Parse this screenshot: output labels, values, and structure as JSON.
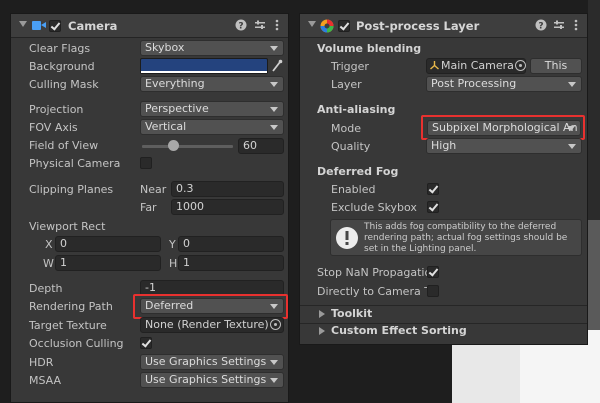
{
  "camera": {
    "title": "Camera",
    "icons": [
      "camera-icon",
      "help-icon",
      "preset-icon",
      "more-icon"
    ],
    "accent_color": "#4a9ff5",
    "rows": {
      "clear_flags": {
        "label": "Clear Flags",
        "value": "Skybox"
      },
      "background": {
        "label": "Background",
        "color": "#24437e"
      },
      "culling_mask": {
        "label": "Culling Mask",
        "value": "Everything"
      },
      "projection": {
        "label": "Projection",
        "value": "Perspective"
      },
      "fov_axis": {
        "label": "FOV Axis",
        "value": "Vertical"
      },
      "field_of_view": {
        "label": "Field of View",
        "value": "60"
      },
      "physical_camera": {
        "label": "Physical Camera",
        "checked": false
      },
      "clipping_planes": {
        "label": "Clipping Planes",
        "near_label": "Near",
        "near": "0.3",
        "far_label": "Far",
        "far": "1000"
      },
      "viewport_rect": {
        "label": "Viewport Rect",
        "x_label": "X",
        "x": "0",
        "y_label": "Y",
        "y": "0",
        "w_label": "W",
        "w": "1",
        "h_label": "H",
        "h": "1"
      },
      "depth": {
        "label": "Depth",
        "value": "-1"
      },
      "rendering_path": {
        "label": "Rendering Path",
        "value": "Deferred"
      },
      "target_texture": {
        "label": "Target Texture",
        "value": "None (Render Texture)"
      },
      "occlusion_culling": {
        "label": "Occlusion Culling",
        "checked": true
      },
      "hdr": {
        "label": "HDR",
        "value": "Use Graphics Settings"
      },
      "msaa": {
        "label": "MSAA",
        "value": "Use Graphics Settings"
      }
    }
  },
  "postprocess": {
    "title": "Post-process Layer",
    "icons": [
      "postprocess-icon",
      "help-icon",
      "preset-icon",
      "more-icon"
    ],
    "volume_blending": {
      "section": "Volume blending",
      "trigger_label": "Trigger",
      "trigger_value": "Main Camera",
      "this_label": "This",
      "layer_label": "Layer",
      "layer_value": "Post Processing"
    },
    "anti_aliasing": {
      "section": "Anti-aliasing",
      "mode_label": "Mode",
      "mode_value": "Subpixel Morphological An",
      "quality_label": "Quality",
      "quality_value": "High"
    },
    "deferred_fog": {
      "section": "Deferred Fog",
      "enabled_label": "Enabled",
      "exclude_skybox_label": "Exclude Skybox",
      "info_line1": "This adds fog compatibility to the deferred",
      "info_line2": "rendering path; actual fog settings should be",
      "info_line3": "set in the Lighting panel."
    },
    "stop_nan_label": "Stop NaN Propagatio",
    "direct_to_camera_label": "Directly to Camera T",
    "toolkit_label": "Toolkit",
    "custom_effect_sorting_label": "Custom Effect Sorting",
    "highlight_color": "#e8312f"
  }
}
